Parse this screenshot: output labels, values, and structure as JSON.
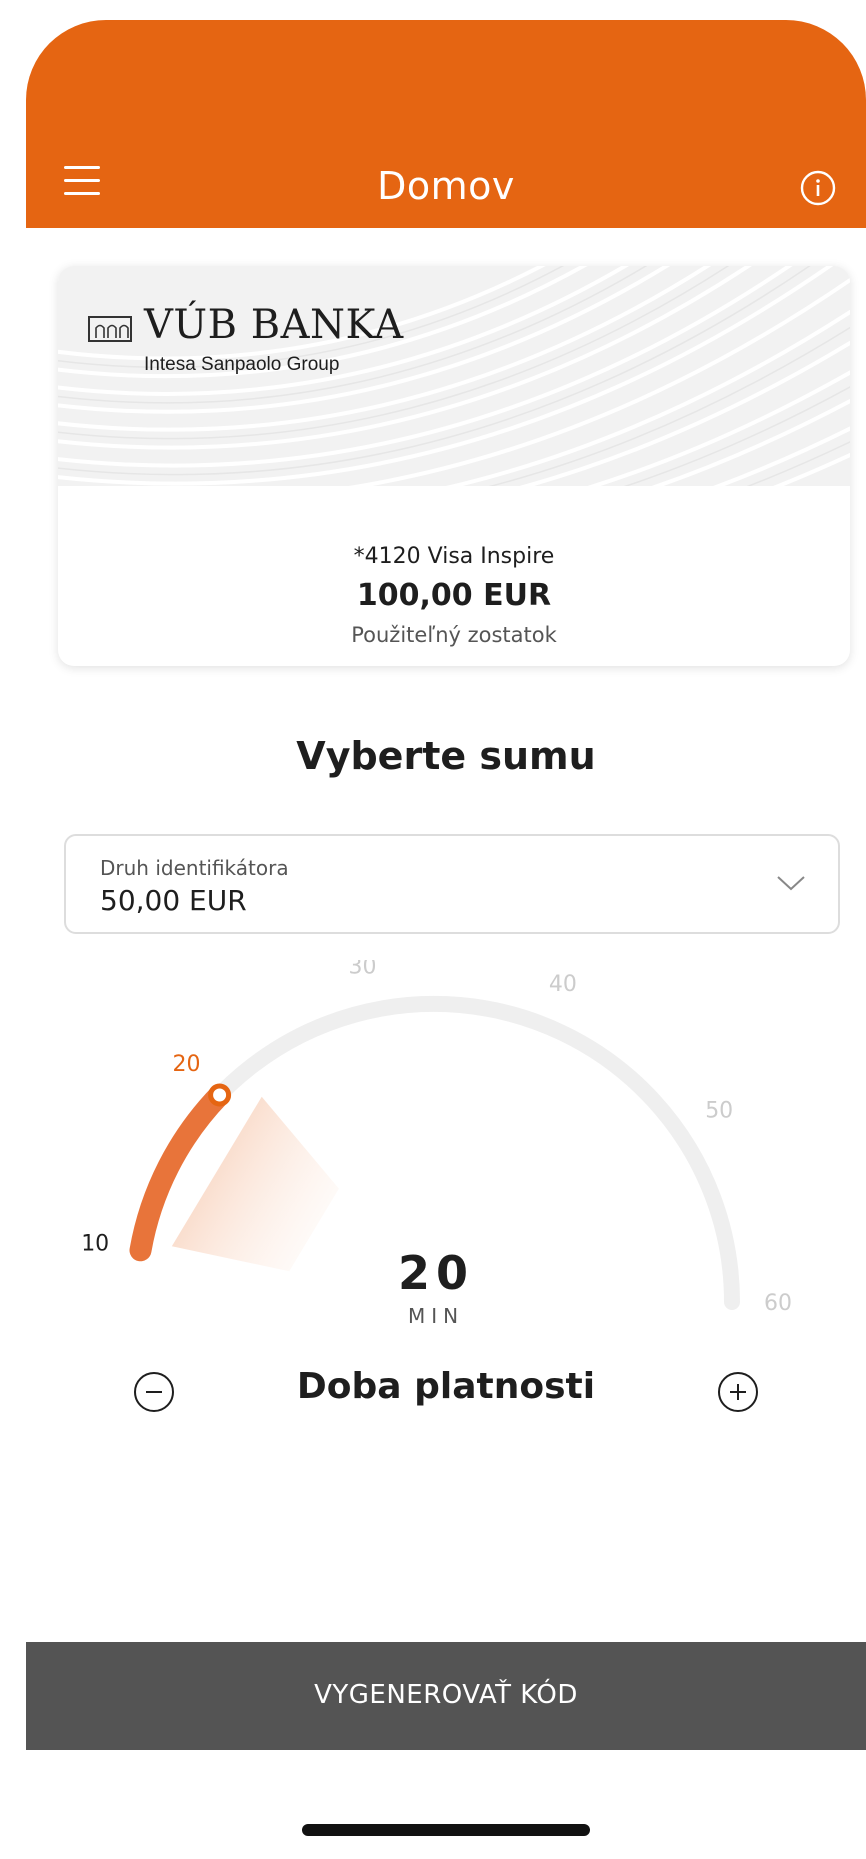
{
  "header": {
    "title": "Domov",
    "menu_icon": "hamburger-icon",
    "info_icon": "info-icon",
    "background": "#e56512"
  },
  "card": {
    "bank_name": "VÚB BANKA",
    "bank_group": "Intesa Sanpaolo Group",
    "card_name": "*4120 Visa Inspire",
    "balance": "100,00 EUR",
    "balance_label": "Použiteľný zostatok"
  },
  "amount": {
    "title": "Vyberte sumu",
    "select_label": "Druh identifikátora",
    "select_value": "50,00 EUR",
    "chevron_icon": "chevron-down-icon"
  },
  "validity": {
    "ticks": [
      "10",
      "20",
      "30",
      "40",
      "50",
      "60"
    ],
    "value": "20",
    "unit": "MIN",
    "min": 10,
    "max": 60,
    "label": "Doba platnosti",
    "accent": "#e56512"
  },
  "footer": {
    "button_label": "VYGENEROVAŤ KÓD",
    "button_color": "#545454"
  }
}
